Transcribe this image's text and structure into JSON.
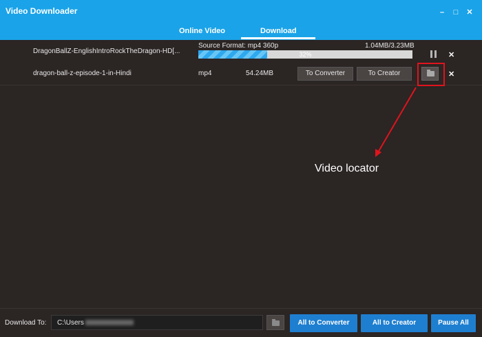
{
  "app": {
    "title": "Video Downloader"
  },
  "window_controls": {
    "minimize": "–",
    "maximize": "□",
    "close": "✕"
  },
  "tabs": [
    {
      "label": "Online Video",
      "active": false
    },
    {
      "label": "Download",
      "active": true
    }
  ],
  "downloads": [
    {
      "name": "DragonBallZ-EnglishIntroRockTheDragon-HD[...",
      "source_format": "Source Format: mp4 360p",
      "size_progress": "1.04MB/3.23MB",
      "progress_label": "32%",
      "progress_fraction": 0.32,
      "status": "downloading"
    },
    {
      "name": "dragon-ball-z-episode-1-in-Hindi",
      "format": "mp4",
      "size": "54.24MB",
      "to_converter_label": "To Converter",
      "to_creator_label": "To Creator",
      "status": "completed"
    }
  ],
  "annotation": {
    "text": "Video locator",
    "color": "#e0141c"
  },
  "bottom": {
    "download_to_label": "Download To:",
    "path_prefix": "C:\\Users",
    "all_to_converter": "All to Converter",
    "all_to_creator": "All to Creator",
    "pause_all": "Pause All"
  },
  "icons": {
    "pause": "pause-icon",
    "close": "close-icon",
    "folder": "folder-icon",
    "dropdown": "chevron-down-icon"
  },
  "colors": {
    "accent": "#1aa3e8",
    "button_blue": "#1e7fd0",
    "background": "#2b2524"
  }
}
